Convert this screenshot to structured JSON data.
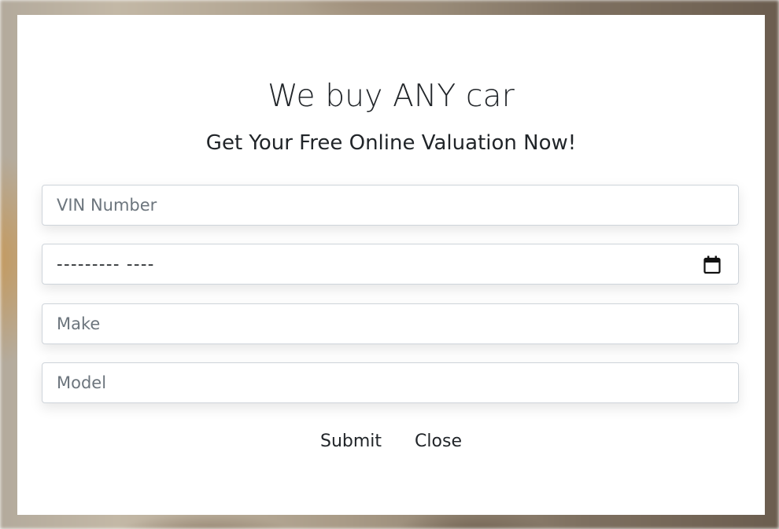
{
  "modal": {
    "title": "We buy ANY car",
    "subtitle": "Get Your Free Online Valuation Now!"
  },
  "form": {
    "vin": {
      "placeholder": "VIN Number",
      "value": ""
    },
    "date": {
      "mask": "--------- ----",
      "icon": "calendar-icon"
    },
    "make": {
      "placeholder": "Make",
      "value": ""
    },
    "model": {
      "placeholder": "Model",
      "value": ""
    }
  },
  "actions": {
    "submit_label": "Submit",
    "close_label": "Close"
  }
}
